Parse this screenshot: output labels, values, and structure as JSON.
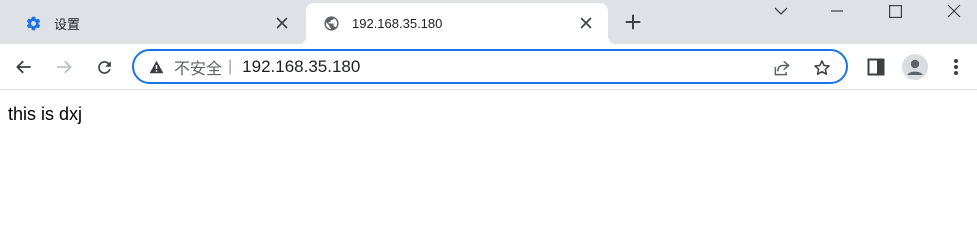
{
  "tabs": [
    {
      "title": "设置",
      "icon": "gear-icon",
      "active": false
    },
    {
      "title": "192.168.35.180",
      "icon": "globe-icon",
      "active": true
    }
  ],
  "omnibox": {
    "security_icon": "warning-icon",
    "security_label": "不安全",
    "separator": "|",
    "url": "192.168.35.180"
  },
  "page": {
    "text": "this is dxj"
  },
  "colors": {
    "tabstrip": "#dee1e6",
    "accent": "#1a73e8",
    "settings_icon": "#1a73e8",
    "icon_gray": "#5f6368"
  }
}
